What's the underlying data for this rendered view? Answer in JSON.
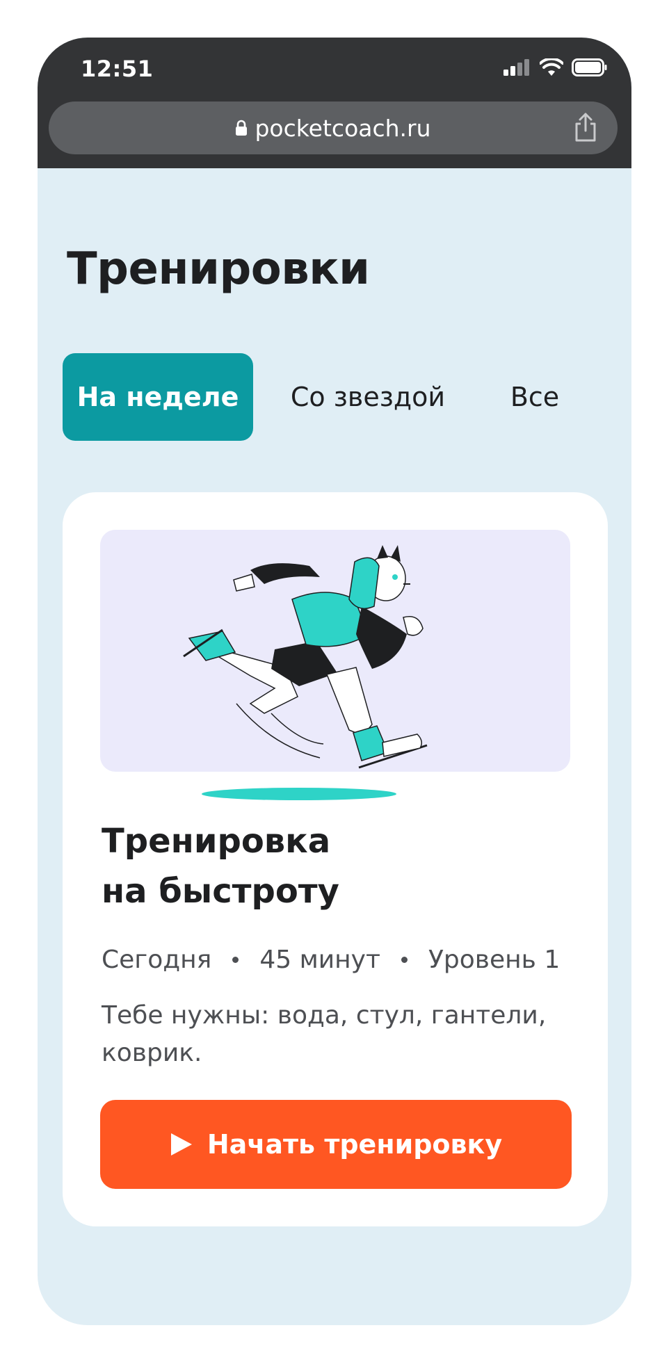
{
  "status_bar": {
    "time": "12:51"
  },
  "browser": {
    "url": "pocketcoach.ru"
  },
  "page": {
    "title": "Тренировки"
  },
  "tabs": [
    {
      "label": "На неделе",
      "active": true
    },
    {
      "label": "Со звездой",
      "active": false
    },
    {
      "label": "Все",
      "active": false
    }
  ],
  "workout_card": {
    "title_line1": "Тренировка",
    "title_line2": "на быстроту",
    "meta": [
      "Сегодня",
      "45 минут",
      "Уровень 1"
    ],
    "requirements": "Тебе нужны: вода, стул, гантели, коврик.",
    "start_button_label": "Начать тренировку"
  },
  "colors": {
    "accent_teal": "#0c9aa1",
    "cta_orange": "#ff5722",
    "page_background": "#e0eef5",
    "hero_background": "#ebeafb",
    "illustration_teal": "#2ed3c7"
  },
  "icons": [
    "lock-icon",
    "share-icon",
    "signal-icon",
    "wifi-icon",
    "battery-icon",
    "play-icon"
  ]
}
